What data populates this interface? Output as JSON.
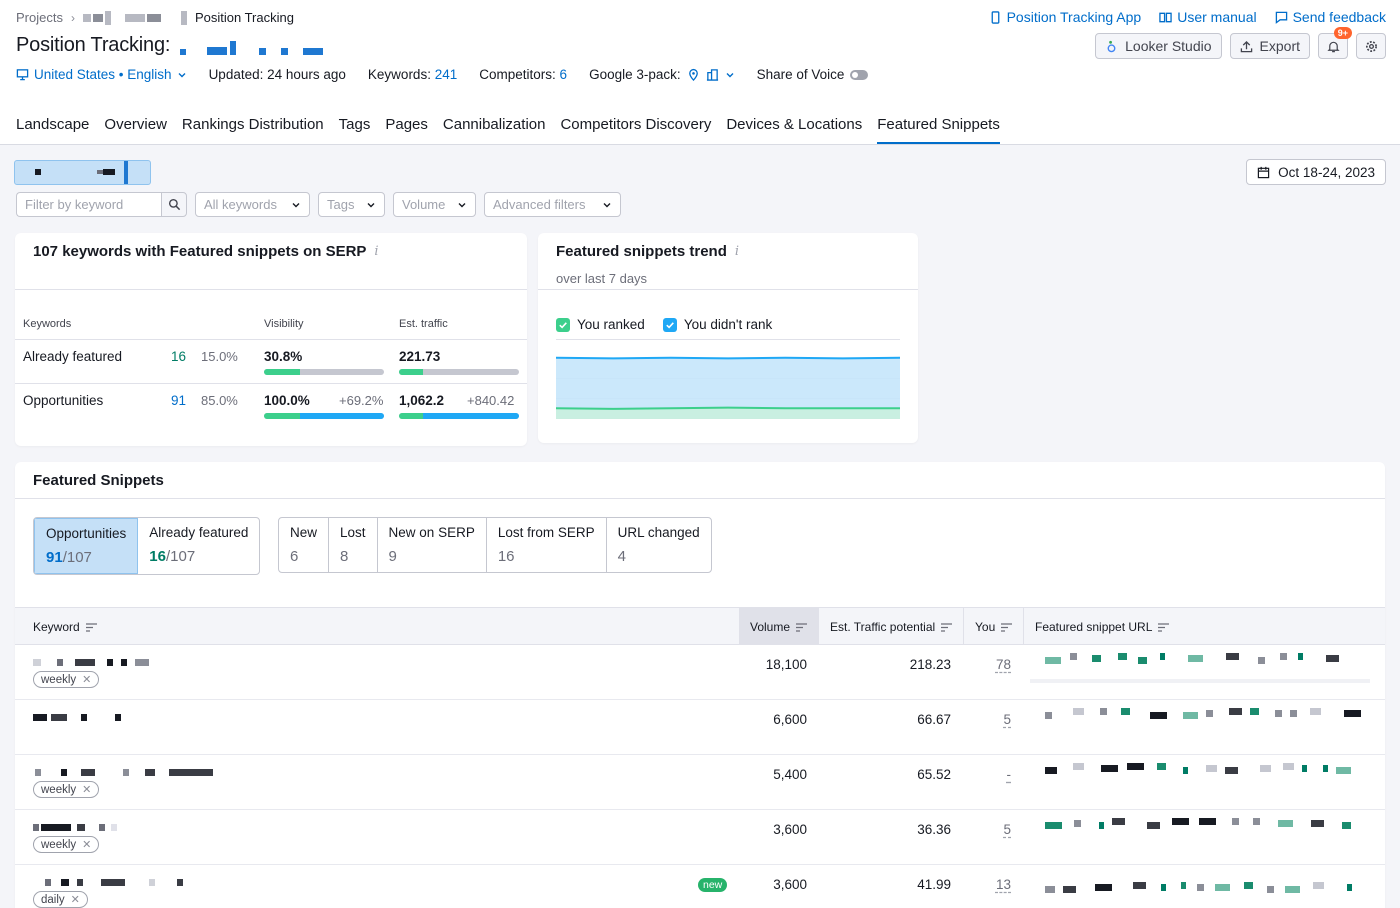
{
  "breadcrumb": {
    "root": "Projects",
    "current": "Position Tracking"
  },
  "top_links": [
    {
      "label": "Position Tracking App",
      "icon": "phone-icon"
    },
    {
      "label": "User manual",
      "icon": "book-icon"
    },
    {
      "label": "Send feedback",
      "icon": "chat-icon"
    }
  ],
  "title": "Position Tracking:",
  "tools": {
    "looker": "Looker Studio",
    "export": "Export",
    "notif_badge": "9+"
  },
  "meta": {
    "location": "United States • English",
    "updated": "Updated: 24 hours ago",
    "keywords_label": "Keywords:",
    "keywords_value": "241",
    "competitors_label": "Competitors:",
    "competitors_value": "6",
    "google_3pack": "Google 3-pack:",
    "share_of_voice": "Share of Voice"
  },
  "tabs": [
    "Landscape",
    "Overview",
    "Rankings Distribution",
    "Tags",
    "Pages",
    "Cannibalization",
    "Competitors Discovery",
    "Devices & Locations",
    "Featured Snippets"
  ],
  "active_tab": "Featured Snippets",
  "date_range": "Oct 18-24, 2023",
  "filters": {
    "keyword_placeholder": "Filter by keyword",
    "all_keywords": "All keywords",
    "tags": "Tags",
    "volume": "Volume",
    "advanced": "Advanced filters"
  },
  "summary": {
    "title": "107 keywords with Featured snippets on SERP",
    "head_keywords": "Keywords",
    "head_visibility": "Visibility",
    "head_traffic": "Est. traffic",
    "rows": [
      {
        "label": "Already featured",
        "count": "16",
        "pct": "15.0%",
        "visibility": "30.8%",
        "vis_delta": "",
        "traffic": "221.73",
        "traffic_delta": "",
        "vis_fill": 0.3,
        "traffic_fill": 0.2,
        "color": "#007c65"
      },
      {
        "label": "Opportunities",
        "count": "91",
        "pct": "85.0%",
        "visibility": "100.0%",
        "vis_delta": "+69.2%",
        "traffic": "1,062.2",
        "traffic_delta": "+840.42",
        "vis_fill": 0.3,
        "traffic_fill": 0.2,
        "color": "#006dca"
      }
    ]
  },
  "trend": {
    "title": "Featured snippets trend",
    "subtitle": "over last 7 days",
    "legend_ranked": "You ranked",
    "legend_not": "You didn't rank",
    "ranked_color": "#3ccf8c",
    "not_color": "#1fa8f5"
  },
  "chart_data": {
    "type": "area",
    "series": [
      {
        "name": "You didn't rank",
        "values": [
          91,
          90,
          91,
          90,
          91,
          90,
          91
        ]
      },
      {
        "name": "You ranked",
        "values": [
          16,
          15,
          16,
          17,
          16,
          16,
          16
        ]
      }
    ],
    "ylim": [
      0,
      107
    ]
  },
  "featured": {
    "title": "Featured Snippets",
    "primary": [
      {
        "label": "Opportunities",
        "value": "91",
        "total": "/107",
        "color": "#006dca",
        "active": true
      },
      {
        "label": "Already featured",
        "value": "16",
        "total": "/107",
        "color": "#007c65",
        "active": false
      }
    ],
    "secondary": [
      {
        "label": "New",
        "value": "6"
      },
      {
        "label": "Lost",
        "value": "8"
      },
      {
        "label": "New on SERP",
        "value": "9"
      },
      {
        "label": "Lost from SERP",
        "value": "16"
      },
      {
        "label": "URL changed",
        "value": "4"
      }
    ]
  },
  "table": {
    "headers": {
      "keyword": "Keyword",
      "volume": "Volume",
      "traffic": "Est. Traffic potential",
      "you": "You",
      "url": "Featured snippet URL"
    },
    "rows": [
      {
        "volume": "18,100",
        "traffic": "218.23",
        "you": "78",
        "tag": "weekly",
        "badge": ""
      },
      {
        "volume": "6,600",
        "traffic": "66.67",
        "you": "5",
        "tag": "",
        "badge": ""
      },
      {
        "volume": "5,400",
        "traffic": "65.52",
        "you": "-",
        "tag": "weekly",
        "badge": ""
      },
      {
        "volume": "3,600",
        "traffic": "36.36",
        "you": "5",
        "tag": "weekly",
        "badge": ""
      },
      {
        "volume": "3,600",
        "traffic": "41.99",
        "you": "13",
        "tag": "daily",
        "badge": "new"
      }
    ]
  }
}
